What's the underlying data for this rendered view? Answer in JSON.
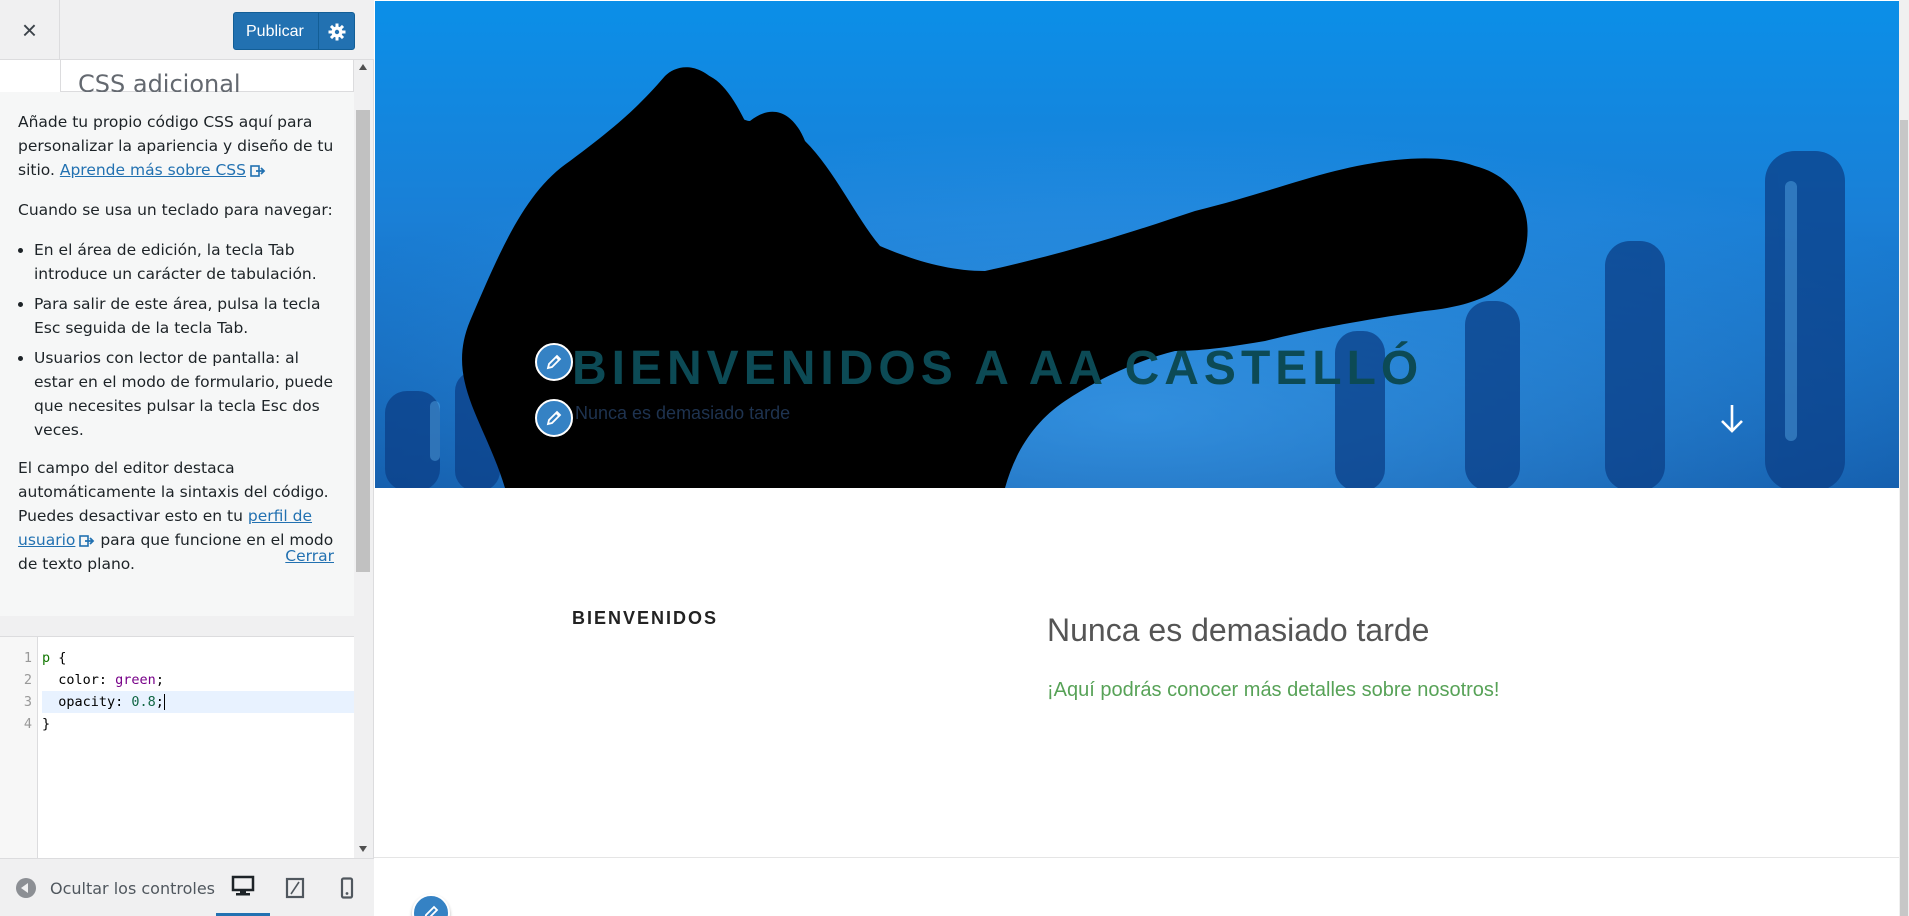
{
  "header": {
    "close_label": "×",
    "publish_label": "Publicar"
  },
  "section": {
    "title": "CSS adicional",
    "desc_intro": "Añade tu propio código CSS aquí para personalizar la apariencia y diseño de tu sitio.",
    "desc_link": "Aprende más sobre CSS",
    "keyboard_intro": "Cuando se usa un teclado para navegar:",
    "keyboard_items": [
      "En el área de edición, la tecla Tab introduce un carácter de tabulación.",
      "Para salir de este área, pulsa la tecla Esc seguida de la tecla Tab.",
      "Usuarios con lector de pantalla: al estar en el modo de formulario, puede que necesites pulsar la tecla Esc dos veces."
    ],
    "syntax_text_1": "El campo del editor destaca automáticamente la sintaxis del código. Puedes desactivar esto en tu",
    "syntax_link": "perfil de usuario",
    "syntax_text_2": "para que funcione en el modo de texto plano.",
    "close_help": "Cerrar"
  },
  "editor": {
    "line_numbers": [
      "1",
      "2",
      "3",
      "4"
    ],
    "lines": [
      {
        "selector": "p",
        "brace": " {"
      },
      {
        "property": "  color:",
        "value": " green",
        "end": ";"
      },
      {
        "property": "  opacity:",
        "value": " 0.8",
        "end": ";"
      },
      {
        "brace": "}"
      }
    ]
  },
  "footer": {
    "collapse_label": "Ocultar los controles",
    "devices": [
      "desktop-icon",
      "tablet-icon",
      "mobile-icon"
    ],
    "active_device": "desktop"
  },
  "preview": {
    "site_title": "BIENVENIDOS A AA CASTELLÓ",
    "site_description": "Nunca es demasiado tarde",
    "intro_heading": "BIENVENIDOS",
    "intro_title": "Nunca es demasiado tarde",
    "intro_text": "¡Aquí podrás conocer más detalles sobre nosotros!"
  },
  "colors": {
    "accent": "#2271b1",
    "site_title": "#0c4a55",
    "paragraph": "green"
  }
}
